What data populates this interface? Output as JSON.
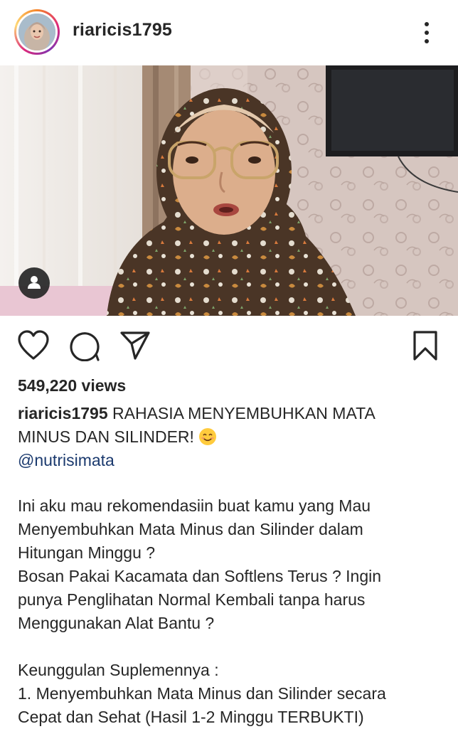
{
  "post": {
    "username": "riaricis1795",
    "views": "549,220 views",
    "caption_user": "riaricis1795",
    "caption_line1": "RAHASIA MENYEMBUHKAN MATA",
    "caption_line2": "MINUS DAN SILINDER!",
    "mention": "@nutrisimata"
  },
  "body": {
    "lines": [
      "Ini aku mau rekomendasiin buat kamu yang Mau",
      "Menyembuhkan Mata Minus dan Silinder dalam",
      "Hitungan Minggu ?",
      "Bosan Pakai Kacamata dan Softlens Terus ? Ingin",
      "punya Penglihatan Normal Kembali tanpa harus",
      "Menggunakan Alat Bantu ?",
      "",
      "Keunggulan Suplemennya :",
      "1. Menyembuhkan Mata Minus dan Silinder secara",
      "Cepat dan Sehat (Hasil 1-2 Minggu TERBUKTI)"
    ]
  },
  "icons": {
    "more": "more-vertical-icon",
    "tag": "user-tag-icon",
    "like": "heart-icon",
    "comment": "comment-icon",
    "share": "send-icon",
    "save": "bookmark-icon",
    "emoji": "smiling-face-emoji"
  },
  "colors": {
    "text": "#262626",
    "mention": "#1b3a6e",
    "background": "#ffffff"
  }
}
